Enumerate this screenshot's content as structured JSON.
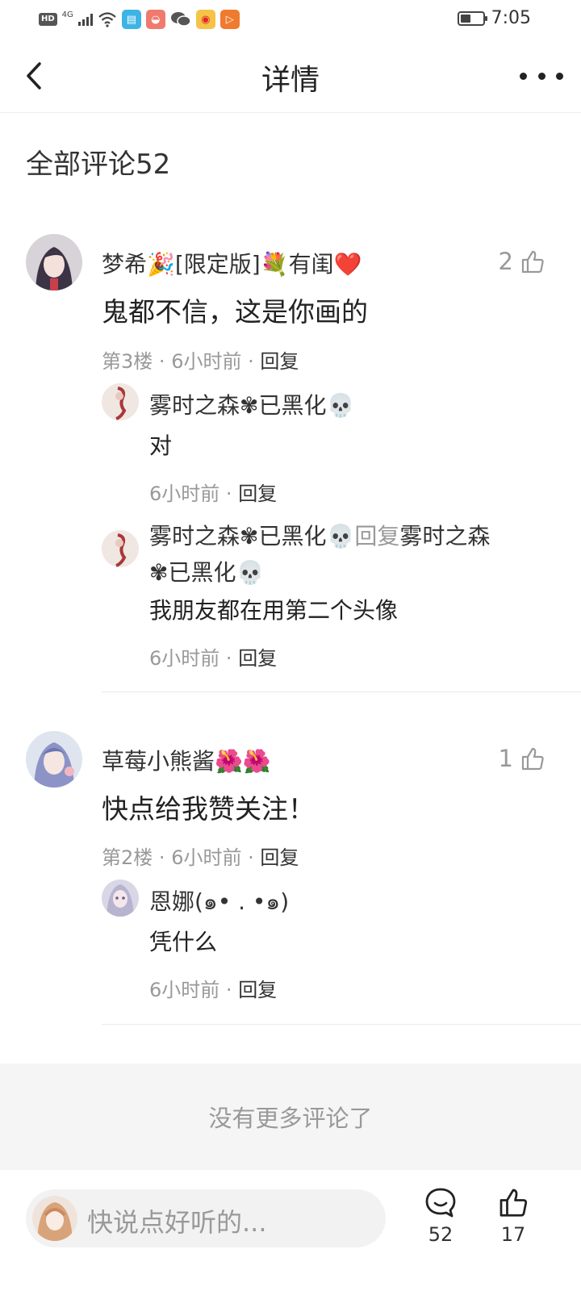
{
  "status_bar": {
    "hd": "HD",
    "network": "4G",
    "time": "7:05"
  },
  "header": {
    "title": "详情"
  },
  "comments_title": "全部评论52",
  "comments": [
    {
      "user": "梦希🎉[限定版]💐有闺❤️",
      "likes": "2",
      "text": "鬼都不信，这是你画的",
      "floor": "第3楼",
      "time": "6小时前",
      "reply_label": "回复",
      "replies": [
        {
          "user": "雾时之森✾已黑化💀",
          "text": "对",
          "time": "6小时前",
          "reply_label": "回复"
        },
        {
          "user": "雾时之森✾已黑化💀",
          "reply_word": "回复",
          "target": "雾时之森",
          "target_cont": "✾已黑化💀",
          "text": "我朋友都在用第二个头像",
          "time": "6小时前",
          "reply_label": "回复"
        }
      ]
    },
    {
      "user": "草莓小熊酱🌺🌺",
      "likes": "1",
      "text": "快点给我赞关注！",
      "floor": "第2楼",
      "time": "6小时前",
      "reply_label": "回复",
      "replies": [
        {
          "user": "恩娜(๑• . •๑)",
          "text": "凭什么",
          "time": "6小时前",
          "reply_label": "回复"
        }
      ]
    }
  ],
  "no_more": "没有更多评论了",
  "bottom_bar": {
    "placeholder": "快说点好听的...",
    "comment_count": "52",
    "like_count": "17"
  },
  "colors": {
    "text": "#222222",
    "muted": "#999999",
    "divider": "#eaeaea",
    "footer_bg": "#f5f5f5"
  }
}
